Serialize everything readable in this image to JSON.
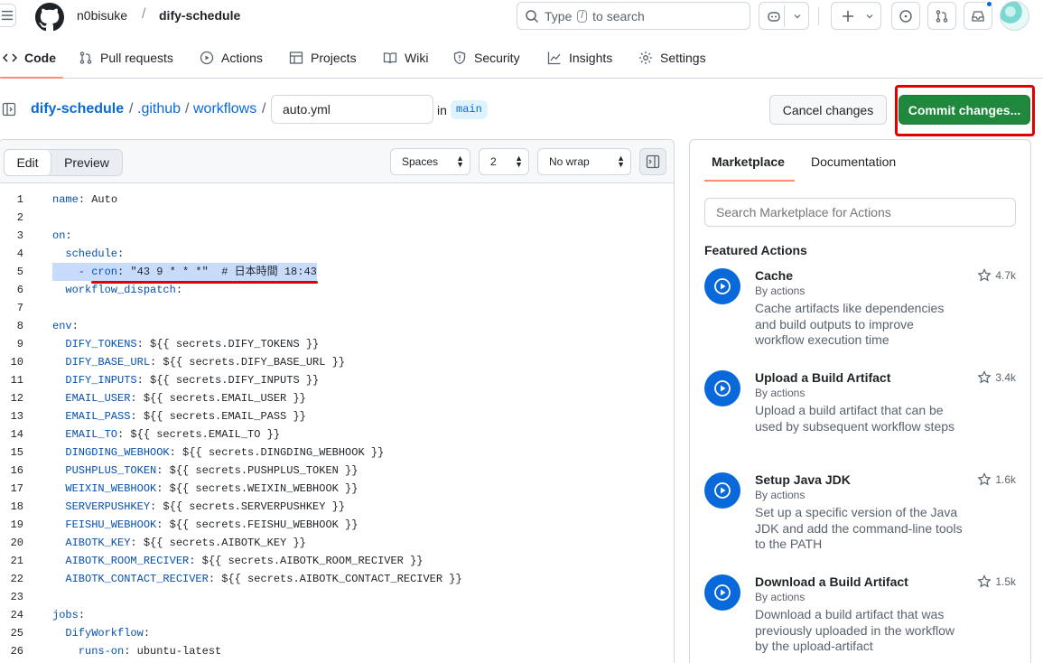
{
  "header": {
    "owner": "n0bisuke",
    "separator": "/",
    "repo": "dify-schedule",
    "search_prefix": "Type",
    "search_key": "/",
    "search_suffix": "to search"
  },
  "nav": {
    "tabs": [
      {
        "label": "Code",
        "icon": "code-icon"
      },
      {
        "label": "Pull requests",
        "icon": "git-pull-request-icon"
      },
      {
        "label": "Actions",
        "icon": "play-icon"
      },
      {
        "label": "Projects",
        "icon": "table-icon"
      },
      {
        "label": "Wiki",
        "icon": "book-icon"
      },
      {
        "label": "Security",
        "icon": "shield-icon"
      },
      {
        "label": "Insights",
        "icon": "graph-icon"
      },
      {
        "label": "Settings",
        "icon": "gear-icon"
      }
    ],
    "active": "Code"
  },
  "breadcrumb": {
    "repo": "dify-schedule",
    "sep": "/",
    "dir1": ".github",
    "dir2": "workflows",
    "filename": "auto.yml",
    "in_label": "in",
    "branch": "main"
  },
  "actions": {
    "cancel": "Cancel changes",
    "commit": "Commit changes..."
  },
  "editor": {
    "edit_tab": "Edit",
    "preview_tab": "Preview",
    "indent_mode": "Spaces",
    "indent_size": "2",
    "wrap_mode": "No wrap",
    "lines": [
      {
        "n": "1",
        "key": "name",
        "rest": ": Auto"
      },
      {
        "n": "2",
        "key": "",
        "rest": ""
      },
      {
        "n": "3",
        "key": "on",
        "rest": ":"
      },
      {
        "n": "4",
        "key": "  schedule",
        "rest": ":"
      },
      {
        "n": "5",
        "key": "    - cron",
        "rest": ": \"43 9 * * *\"  # 日本時間 18:43"
      },
      {
        "n": "6",
        "key": "  workflow_dispatch",
        "rest": ":"
      },
      {
        "n": "7",
        "key": "",
        "rest": ""
      },
      {
        "n": "8",
        "key": "env",
        "rest": ":"
      },
      {
        "n": "9",
        "key": "  DIFY_TOKENS",
        "rest": ": ${{ secrets.DIFY_TOKENS }}"
      },
      {
        "n": "10",
        "key": "  DIFY_BASE_URL",
        "rest": ": ${{ secrets.DIFY_BASE_URL }}"
      },
      {
        "n": "11",
        "key": "  DIFY_INPUTS",
        "rest": ": ${{ secrets.DIFY_INPUTS }}"
      },
      {
        "n": "12",
        "key": "  EMAIL_USER",
        "rest": ": ${{ secrets.EMAIL_USER }}"
      },
      {
        "n": "13",
        "key": "  EMAIL_PASS",
        "rest": ": ${{ secrets.EMAIL_PASS }}"
      },
      {
        "n": "14",
        "key": "  EMAIL_TO",
        "rest": ": ${{ secrets.EMAIL_TO }}"
      },
      {
        "n": "15",
        "key": "  DINGDING_WEBHOOK",
        "rest": ": ${{ secrets.DINGDING_WEBHOOK }}"
      },
      {
        "n": "16",
        "key": "  PUSHPLUS_TOKEN",
        "rest": ": ${{ secrets.PUSHPLUS_TOKEN }}"
      },
      {
        "n": "17",
        "key": "  WEIXIN_WEBHOOK",
        "rest": ": ${{ secrets.WEIXIN_WEBHOOK }}"
      },
      {
        "n": "18",
        "key": "  SERVERPUSHKEY",
        "rest": ": ${{ secrets.SERVERPUSHKEY }}"
      },
      {
        "n": "19",
        "key": "  FEISHU_WEBHOOK",
        "rest": ": ${{ secrets.FEISHU_WEBHOOK }}"
      },
      {
        "n": "20",
        "key": "  AIBOTK_KEY",
        "rest": ": ${{ secrets.AIBOTK_KEY }}"
      },
      {
        "n": "21",
        "key": "  AIBOTK_ROOM_RECIVER",
        "rest": ": ${{ secrets.AIBOTK_ROOM_RECIVER }}"
      },
      {
        "n": "22",
        "key": "  AIBOTK_CONTACT_RECIVER",
        "rest": ": ${{ secrets.AIBOTK_CONTACT_RECIVER }}"
      },
      {
        "n": "23",
        "key": "",
        "rest": ""
      },
      {
        "n": "24",
        "key": "jobs",
        "rest": ":"
      },
      {
        "n": "25",
        "key": "  DifyWorkflow",
        "rest": ":"
      },
      {
        "n": "26",
        "key": "    runs-on",
        "rest": ": ubuntu-latest"
      }
    ]
  },
  "sidebar": {
    "tab_marketplace": "Marketplace",
    "tab_documentation": "Documentation",
    "search_placeholder": "Search Marketplace for Actions",
    "featured_title": "Featured Actions",
    "items": [
      {
        "name": "Cache",
        "by": "By actions",
        "desc": "Cache artifacts like dependencies and build outputs to improve workflow execution time",
        "stars": "4.7k"
      },
      {
        "name": "Upload a Build Artifact",
        "by": "By actions",
        "desc": "Upload a build artifact that can be used by subsequent workflow steps",
        "stars": "3.4k"
      },
      {
        "name": "Setup Java JDK",
        "by": "By actions",
        "desc": "Set up a specific version of the Java JDK and add the command-line tools to the PATH",
        "stars": "1.6k"
      },
      {
        "name": "Download a Build Artifact",
        "by": "By actions",
        "desc": "Download a build artifact that was previously uploaded in the workflow by the upload-artifact",
        "stars": "1.5k"
      }
    ]
  },
  "colors": {
    "accent": "#0969da",
    "commit_green": "#1f883d",
    "annotation_red": "#e00000",
    "tab_underline": "#fd8c73"
  }
}
